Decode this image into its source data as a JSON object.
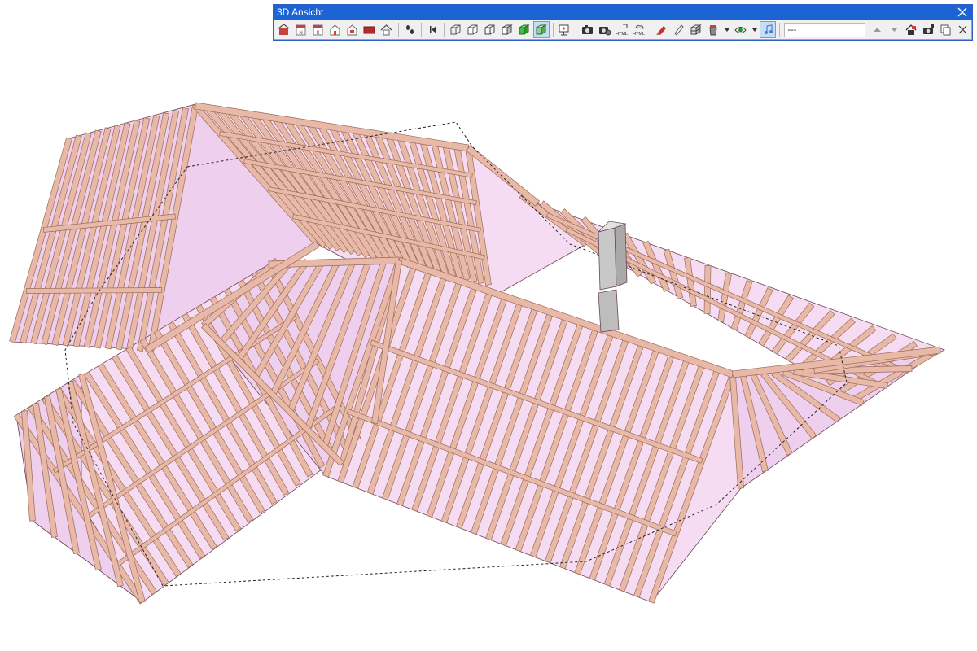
{
  "window": {
    "title": "3D Ansicht",
    "view_combo": "---"
  },
  "toolbar": [
    {
      "name": "view-house-icon"
    },
    {
      "name": "view-north-icon"
    },
    {
      "name": "view-south-icon"
    },
    {
      "name": "view-house-outline-icon"
    },
    {
      "name": "view-house-outline-2-icon"
    },
    {
      "name": "view-roof-red-icon"
    },
    {
      "name": "view-home-icon"
    },
    {
      "sep": true
    },
    {
      "name": "walk-footsteps-icon"
    },
    {
      "sep": true
    },
    {
      "name": "skip-back-icon"
    },
    {
      "sep": true
    },
    {
      "name": "wireframe-cube-icon"
    },
    {
      "name": "hidden-line-cube-icon"
    },
    {
      "name": "outline-cube-icon"
    },
    {
      "name": "shaded-cube-icon"
    },
    {
      "name": "green-cube-icon"
    },
    {
      "name": "textured-cube-icon",
      "active": true
    },
    {
      "sep": true
    },
    {
      "name": "presentation-icon"
    },
    {
      "sep": true
    },
    {
      "name": "camera-icon"
    },
    {
      "name": "camera-settings-icon"
    },
    {
      "name": "html-export-icon",
      "text": "HTML"
    },
    {
      "name": "html-cloud-export-icon",
      "text": "HTML"
    },
    {
      "sep": true
    },
    {
      "name": "marker-icon"
    },
    {
      "name": "pencil-icon"
    },
    {
      "name": "layers-cube-icon"
    },
    {
      "name": "material-bucket-icon",
      "dropdown": true
    },
    {
      "name": "visibility-eye-icon",
      "dropdown": true
    },
    {
      "name": "music-note-icon",
      "active": true
    }
  ],
  "toolbar_tail": [
    {
      "name": "arrow-up-icon"
    },
    {
      "name": "arrow-down-icon"
    },
    {
      "name": "home-save-icon"
    },
    {
      "name": "camera-save-icon"
    },
    {
      "name": "copy-view-icon"
    },
    {
      "name": "close-small-icon"
    }
  ],
  "colors": {
    "title_bar": "#1c63d3",
    "roof_fill": "#f6dcf3",
    "roof_fill_shade": "#efcfee",
    "timber": "#e9b9a8",
    "timber_edge": "#9a6a5c",
    "chimney": "#c8c8c8"
  }
}
